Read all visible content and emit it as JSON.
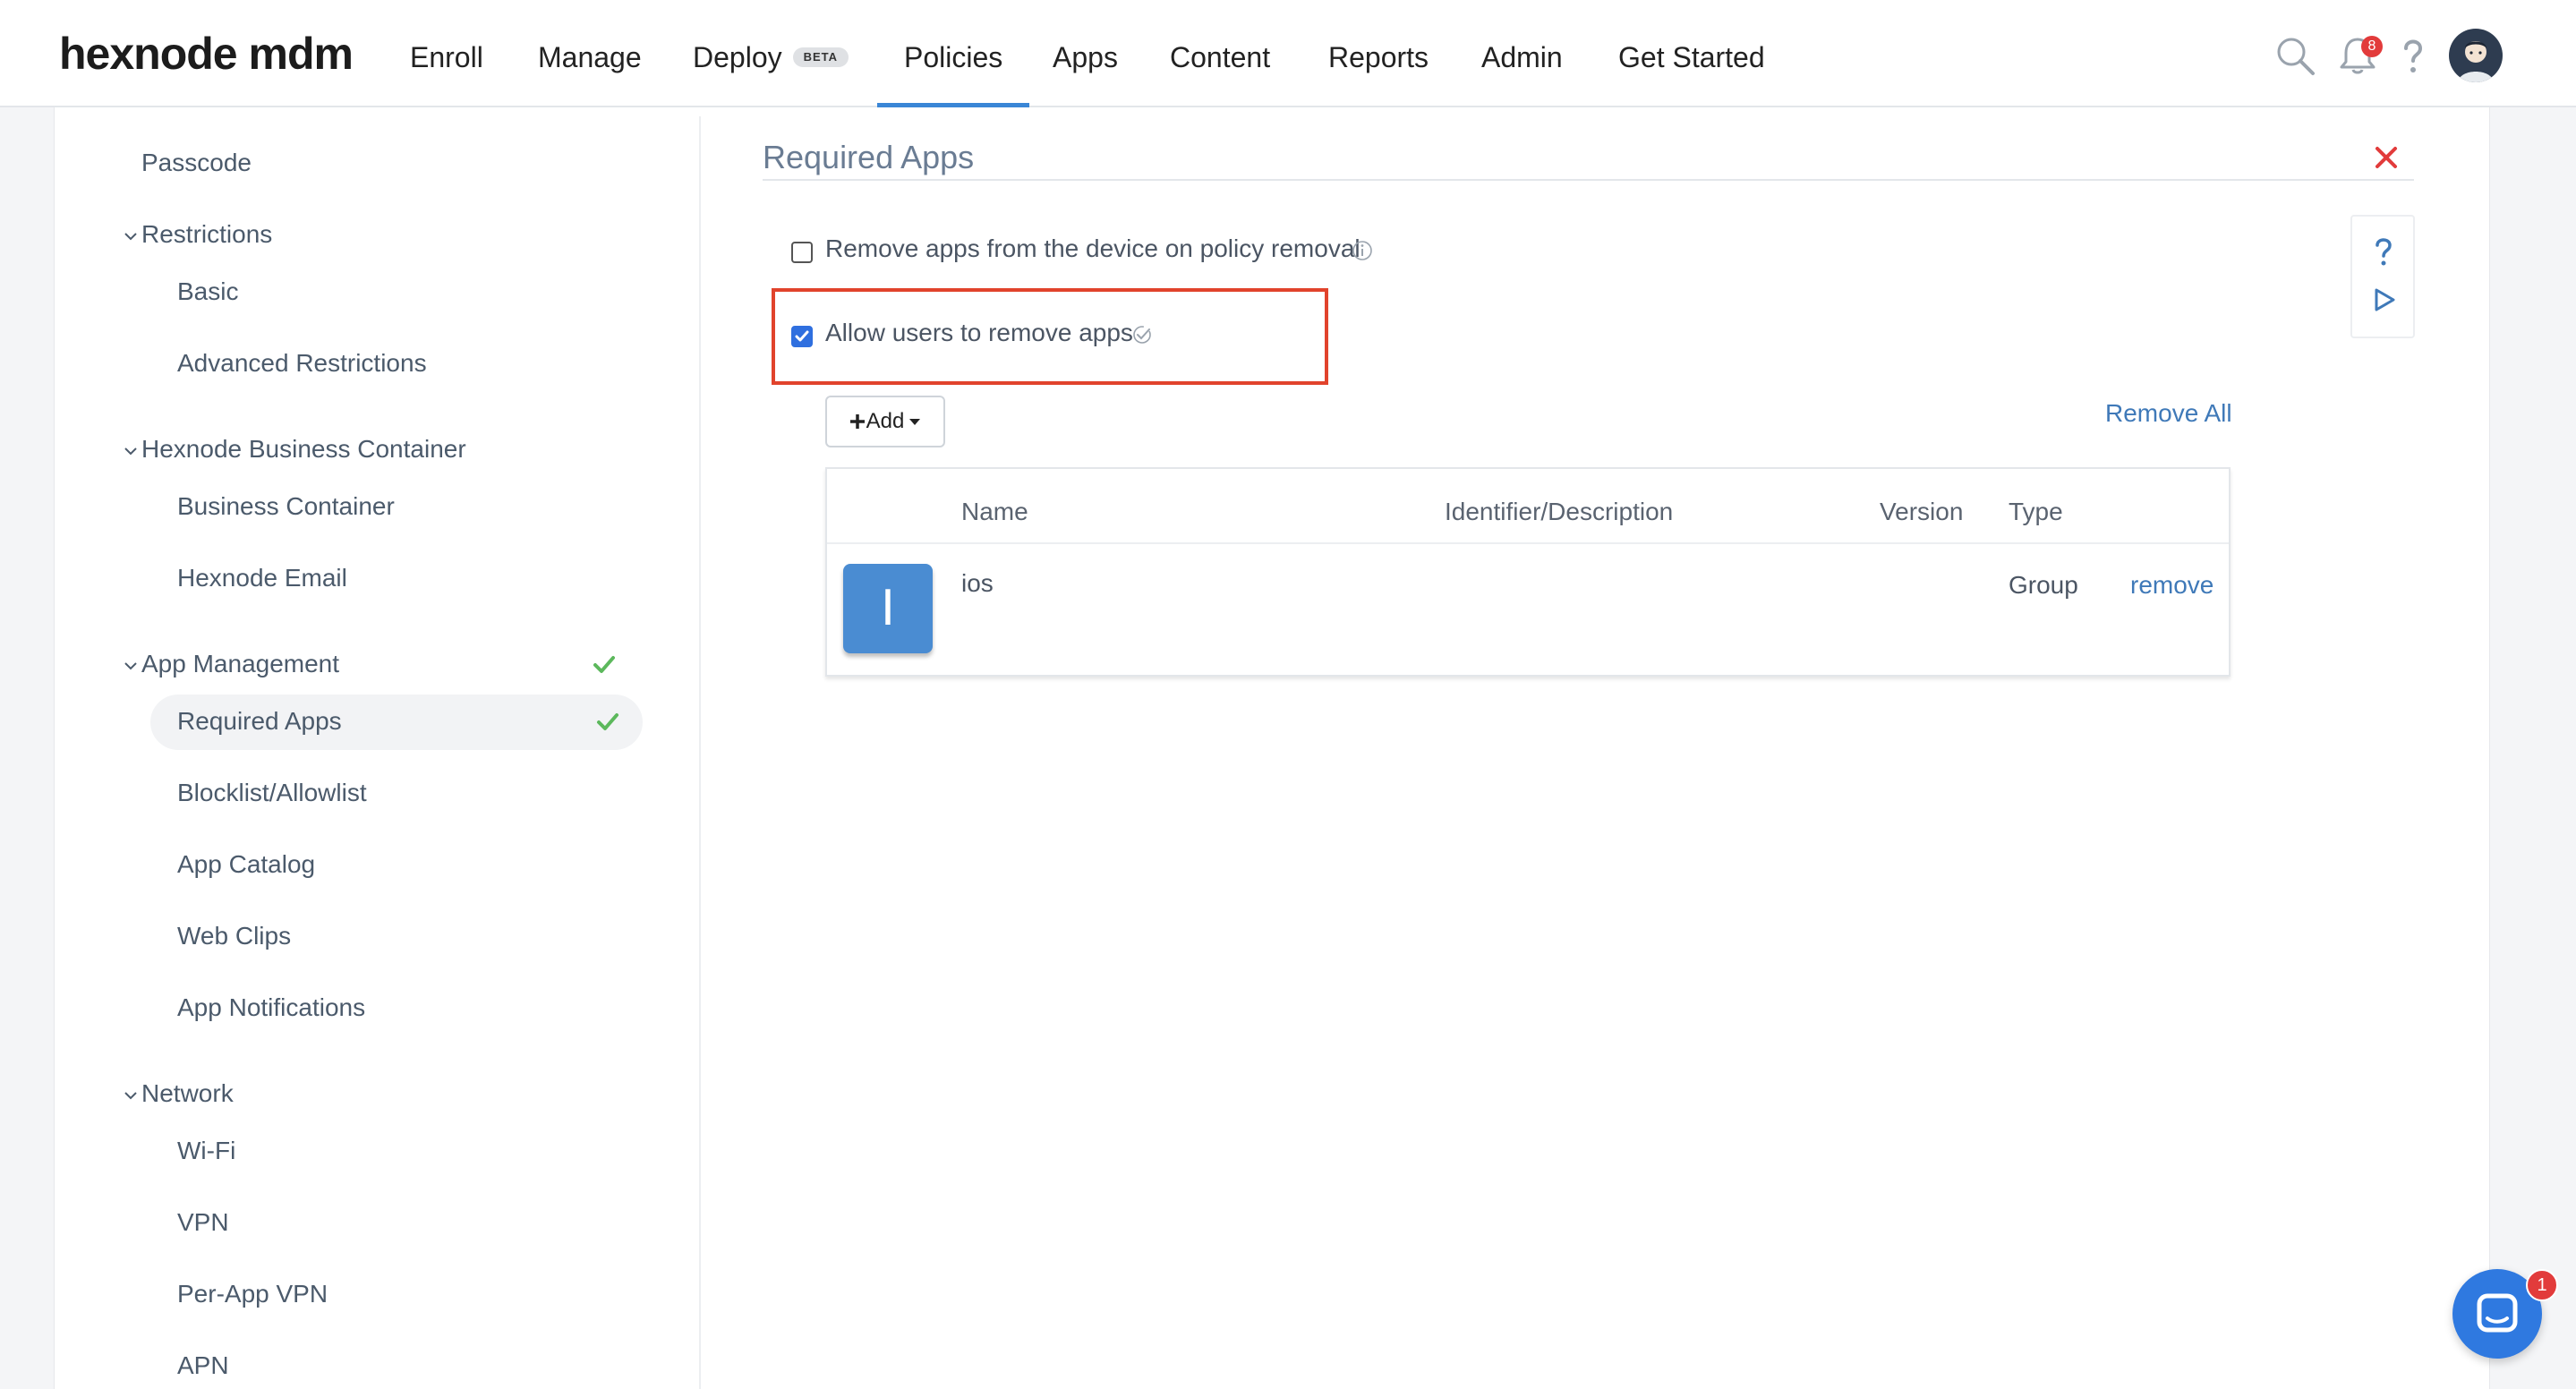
{
  "brand": {
    "logo": "hexnode mdm"
  },
  "nav": {
    "items": [
      "Enroll",
      "Manage",
      "Deploy",
      "Policies",
      "Apps",
      "Content",
      "Reports",
      "Admin",
      "Get Started"
    ],
    "deploy_badge": "BETA",
    "active": "Policies",
    "notification_count": "8"
  },
  "sidebar": {
    "passcode": "Passcode",
    "restrictions": {
      "label": "Restrictions",
      "items": [
        "Basic",
        "Advanced Restrictions"
      ]
    },
    "business_container": {
      "label": "Hexnode Business Container",
      "items": [
        "Business Container",
        "Hexnode Email"
      ]
    },
    "app_management": {
      "label": "App Management",
      "items": [
        "Required Apps",
        "Blocklist/Allowlist",
        "App Catalog",
        "Web Clips",
        "App Notifications"
      ],
      "active": "Required Apps"
    },
    "network": {
      "label": "Network",
      "items": [
        "Wi-Fi",
        "VPN",
        "Per-App VPN",
        "APN"
      ]
    }
  },
  "main": {
    "title": "Required Apps",
    "options": [
      {
        "label": "Remove apps from the device on policy removal",
        "checked": false
      },
      {
        "label": "Allow users to remove apps",
        "checked": true
      }
    ],
    "add_label": "Add",
    "remove_all_label": "Remove All",
    "table": {
      "headers": [
        "Name",
        "Identifier/Description",
        "Version",
        "Type"
      ],
      "rows": [
        {
          "icon_letter": "I",
          "name": "ios",
          "identifier": "",
          "version": "",
          "type": "Group",
          "action": "remove"
        }
      ]
    }
  },
  "chat": {
    "badge": "1"
  },
  "colors": {
    "accent": "#3a86d6",
    "link": "#3f79b8",
    "highlight": "#e1432c",
    "success": "#5cb85c",
    "app_tile": "#4a8cd2"
  }
}
